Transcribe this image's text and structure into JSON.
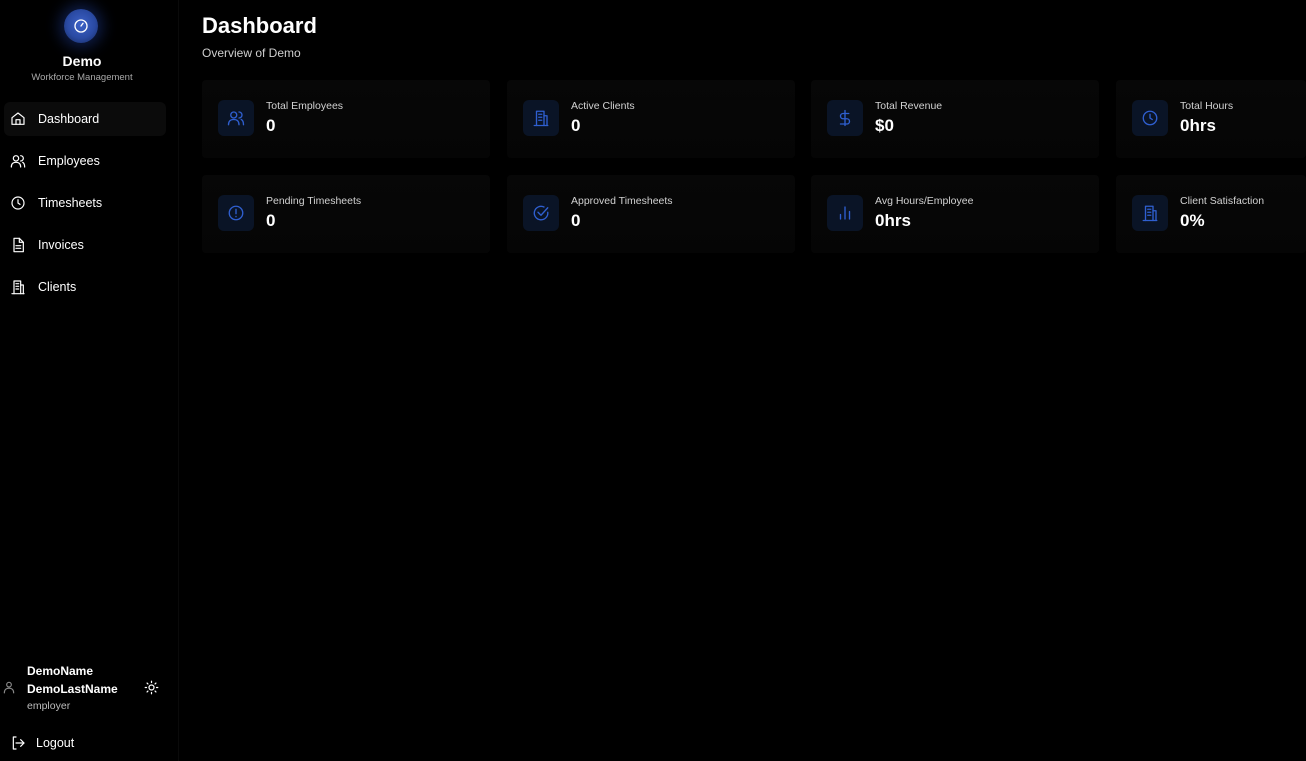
{
  "brand": {
    "title": "Demo",
    "subtitle": "Workforce Management",
    "accent": "#3b5fc4"
  },
  "sidebar": {
    "items": [
      {
        "label": "Dashboard",
        "icon": "home-icon",
        "active": true
      },
      {
        "label": "Employees",
        "icon": "users-icon"
      },
      {
        "label": "Timesheets",
        "icon": "clock-icon"
      },
      {
        "label": "Invoices",
        "icon": "file-text-icon"
      },
      {
        "label": "Clients",
        "icon": "building-icon"
      }
    ]
  },
  "user": {
    "first_name": "DemoName",
    "last_name": "DemoLastName",
    "role": "employer"
  },
  "logout_label": "Logout",
  "header": {
    "title": "Dashboard",
    "subtitle": "Overview of Demo"
  },
  "stats": [
    {
      "label": "Total Employees",
      "value": "0",
      "icon": "users-icon"
    },
    {
      "label": "Active Clients",
      "value": "0",
      "icon": "building-icon"
    },
    {
      "label": "Total Revenue",
      "value": "$0",
      "icon": "dollar-icon"
    },
    {
      "label": "Total Hours",
      "value": "0hrs",
      "icon": "clock-icon"
    },
    {
      "label": "Pending Timesheets",
      "value": "0",
      "icon": "alert-circle-icon"
    },
    {
      "label": "Approved Timesheets",
      "value": "0",
      "icon": "check-circle-icon"
    },
    {
      "label": "Avg Hours/Employee",
      "value": "0hrs",
      "icon": "bar-chart-icon"
    },
    {
      "label": "Client Satisfaction",
      "value": "0%",
      "icon": "building-icon"
    }
  ],
  "colors": {
    "background": "#000000",
    "card": "#070707",
    "icon_bg": "#0a1426",
    "icon_accent": "#2f5fd0"
  }
}
